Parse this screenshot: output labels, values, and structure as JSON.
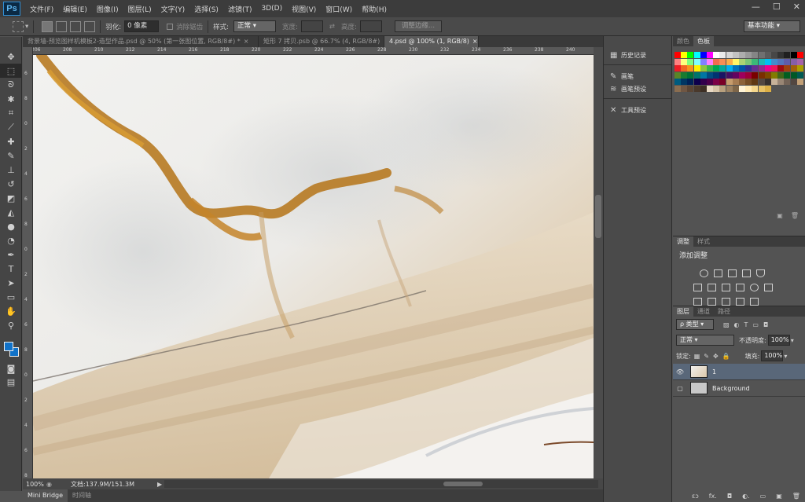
{
  "app": {
    "logo": "Ps"
  },
  "menu": [
    "文件(F)",
    "编辑(E)",
    "图像(I)",
    "图层(L)",
    "文字(Y)",
    "选择(S)",
    "滤镜(T)",
    "3D(D)",
    "视图(V)",
    "窗口(W)",
    "帮助(H)"
  ],
  "window_controls": {
    "minimize": "—",
    "maximize": "☐",
    "close": "✕"
  },
  "options": {
    "feather_label": "羽化:",
    "feather_value": "0 像素",
    "antialias_label": "消除锯齿",
    "style_label": "样式:",
    "style_value": "正常",
    "width_label": "宽度:",
    "height_label": "高度:",
    "refine_button": "调整边缘...",
    "workspace": "基本功能"
  },
  "tabs": [
    {
      "label": "背景墙-预览图样机模板2-造型作品.psd @ 50% (第一张图位置, RGB/8#) *",
      "close": "×"
    },
    {
      "label": "矩形 7 拷贝.psb @ 66.7% (4, RGB/8#)",
      "close": "×"
    },
    {
      "label": "4.psd @ 100% (1, RGB/8)",
      "close": "×"
    }
  ],
  "ruler": {
    "top": [
      "206",
      "208",
      "210",
      "212",
      "214",
      "216",
      "218",
      "220",
      "222",
      "224",
      "226",
      "228",
      "230",
      "232",
      "234",
      "236",
      "238",
      "240"
    ],
    "left": [
      "6",
      "8",
      "0",
      "2",
      "4",
      "6",
      "8",
      "0",
      "2",
      "4",
      "6",
      "8",
      "0",
      "2",
      "4",
      "6",
      "8"
    ]
  },
  "status": {
    "zoom": "100%",
    "doc": "文档:137.9M/151.3M",
    "arrow": "▶"
  },
  "bottom_tabs": [
    "Mini Bridge",
    "时间轴"
  ],
  "dock": [
    "历史记录",
    "画笔",
    "画笔预设",
    "工具预设"
  ],
  "swatch_panel": {
    "tabs": [
      "颜色",
      "色板"
    ]
  },
  "swatch_colors": [
    [
      "#ff0000",
      "#ffff00",
      "#00ff00",
      "#00ffff",
      "#0000ff",
      "#ff00ff",
      "#ffffff",
      "#ebebeb",
      "#d6d6d6",
      "#c2c2c2",
      "#adadad",
      "#999999",
      "#858585",
      "#707070",
      "#5c5c5c",
      "#474747",
      "#333333",
      "#1f1f1f",
      "#000000",
      "#ff0000"
    ],
    [
      "#ff8080",
      "#ffff80",
      "#80ff80",
      "#80ffff",
      "#8080ff",
      "#ff80ff",
      "#f26c4f",
      "#f68e55",
      "#fbad4a",
      "#fff568",
      "#acd373",
      "#7cc576",
      "#3bb878",
      "#1abbb4",
      "#00bff3",
      "#438ccb",
      "#5574b9",
      "#605ca8",
      "#855fa8",
      "#a763a8"
    ],
    [
      "#ed1c24",
      "#f26522",
      "#f7941d",
      "#fff200",
      "#8dc63f",
      "#39b54a",
      "#00a651",
      "#00a99d",
      "#00aeef",
      "#0072bc",
      "#0054a6",
      "#2e3192",
      "#662d91",
      "#92278f",
      "#ec008c",
      "#ed145b",
      "#9e0b0f",
      "#a0410d",
      "#a36209",
      "#aba000"
    ],
    [
      "#598527",
      "#1a7b30",
      "#007236",
      "#00746b",
      "#0076a3",
      "#004a80",
      "#003471",
      "#1b1464",
      "#440e62",
      "#630460",
      "#9e005d",
      "#9e0039",
      "#790000",
      "#7b2e00",
      "#7d4900",
      "#827b00",
      "#406618",
      "#005e20",
      "#005826",
      "#005952"
    ],
    [
      "#005b7f",
      "#003663",
      "#002157",
      "#0d004c",
      "#32004b",
      "#4b0049",
      "#7b0046",
      "#7a0026",
      "#c69c6d",
      "#a67c52",
      "#8c6239",
      "#754c24",
      "#603913",
      "#534741",
      "#362f2d",
      "#c7b299",
      "#998675",
      "#736357",
      "#534741",
      "#c2a077"
    ],
    [
      "#8a6d50",
      "#6f5643",
      "#5a4535",
      "#4a392c",
      "#3d2f24",
      "#e8d9c4",
      "#d6c4a8",
      "#b8a07e",
      "#9b8161",
      "#7e6649",
      "#fff3d6",
      "#ffe9b3",
      "#f5d78c",
      "#e8c266",
      "#dcae45"
    ]
  ],
  "adjust_panel": {
    "tabs": [
      "调整",
      "样式"
    ],
    "title": "添加调整"
  },
  "layers_panel": {
    "tabs": [
      "图层",
      "通道",
      "路径"
    ],
    "filter": "ρ 类型",
    "blend": "正常",
    "opacity_label": "不透明度:",
    "opacity": "100%",
    "lock_label": "锁定:",
    "fill_label": "填充:",
    "fill": "100%",
    "layers": [
      {
        "name": "1",
        "visible": true,
        "selected": true
      },
      {
        "name": "Background",
        "visible": false,
        "selected": false
      }
    ],
    "footer": [
      "ɛɔ",
      "fx.",
      "◘",
      "◐.",
      "▭",
      "▣",
      "🗑"
    ]
  }
}
